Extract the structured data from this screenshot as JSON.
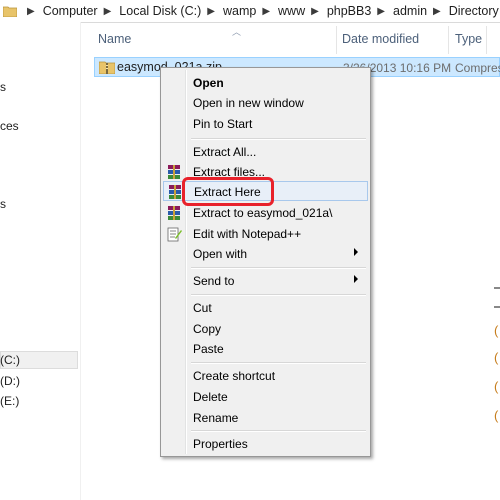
{
  "breadcrumb": {
    "items": [
      "Computer",
      "Local Disk (C:)",
      "wamp",
      "www",
      "phpBB3",
      "admin",
      "Directory"
    ]
  },
  "nav": {
    "fragments": [
      "s",
      "ces",
      "s"
    ],
    "drives": [
      "(C:)",
      "(D:)",
      "(E:)"
    ]
  },
  "columns": {
    "name": "Name",
    "date_modified": "Date modified",
    "type": "Type"
  },
  "file": {
    "name": "easymod_021a.zip",
    "date": "3/26/2013 10:16 PM",
    "type": "Compres"
  },
  "context_menu": {
    "open": "Open",
    "open_new_window": "Open in new window",
    "pin_to_start": "Pin to Start",
    "extract_all": "Extract All...",
    "extract_files": "Extract files...",
    "extract_here": "Extract Here",
    "extract_to": "Extract to easymod_021a\\",
    "edit_notepad": "Edit with Notepad++",
    "open_with": "Open with",
    "send_to": "Send to",
    "cut": "Cut",
    "copy": "Copy",
    "paste": "Paste",
    "create_shortcut": "Create shortcut",
    "delete": "Delete",
    "rename": "Rename",
    "properties": "Properties"
  },
  "colors": {
    "highlight": "#e8212b",
    "selection": "#cce8ff"
  }
}
